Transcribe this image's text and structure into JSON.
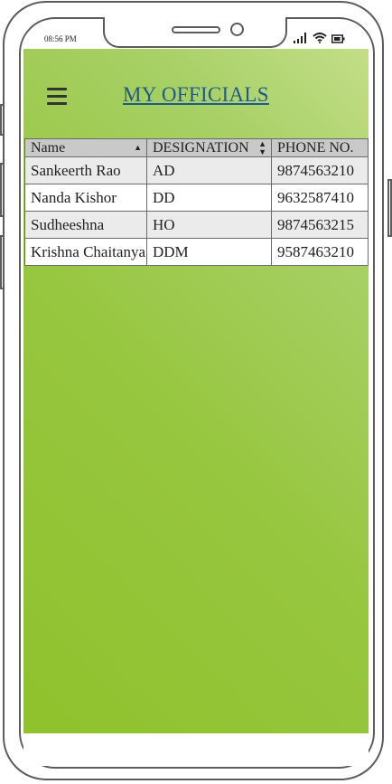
{
  "status_bar": {
    "time": "08:56 PM"
  },
  "header": {
    "title": "MY OFFICIALS"
  },
  "table": {
    "columns": [
      "Name",
      "DESIGNATION",
      "PHONE NO."
    ],
    "rows": [
      [
        "Sankeerth Rao",
        "AD",
        "9874563210"
      ],
      [
        "Nanda Kishor",
        "DD",
        "9632587410"
      ],
      [
        "Sudheeshna",
        "HO",
        "9874563215"
      ],
      [
        "Krishna Chaitanya",
        "DDM",
        "9587463210"
      ]
    ]
  },
  "colors": {
    "gradient_light": "#c3de88",
    "gradient_dark": "#8fc22c",
    "title": "#1f5a8c",
    "header_bg": "#c9c9c9"
  },
  "icons": {
    "menu": "hamburger-icon",
    "signal": "signal-icon",
    "wifi": "wifi-icon",
    "battery": "battery-icon"
  }
}
